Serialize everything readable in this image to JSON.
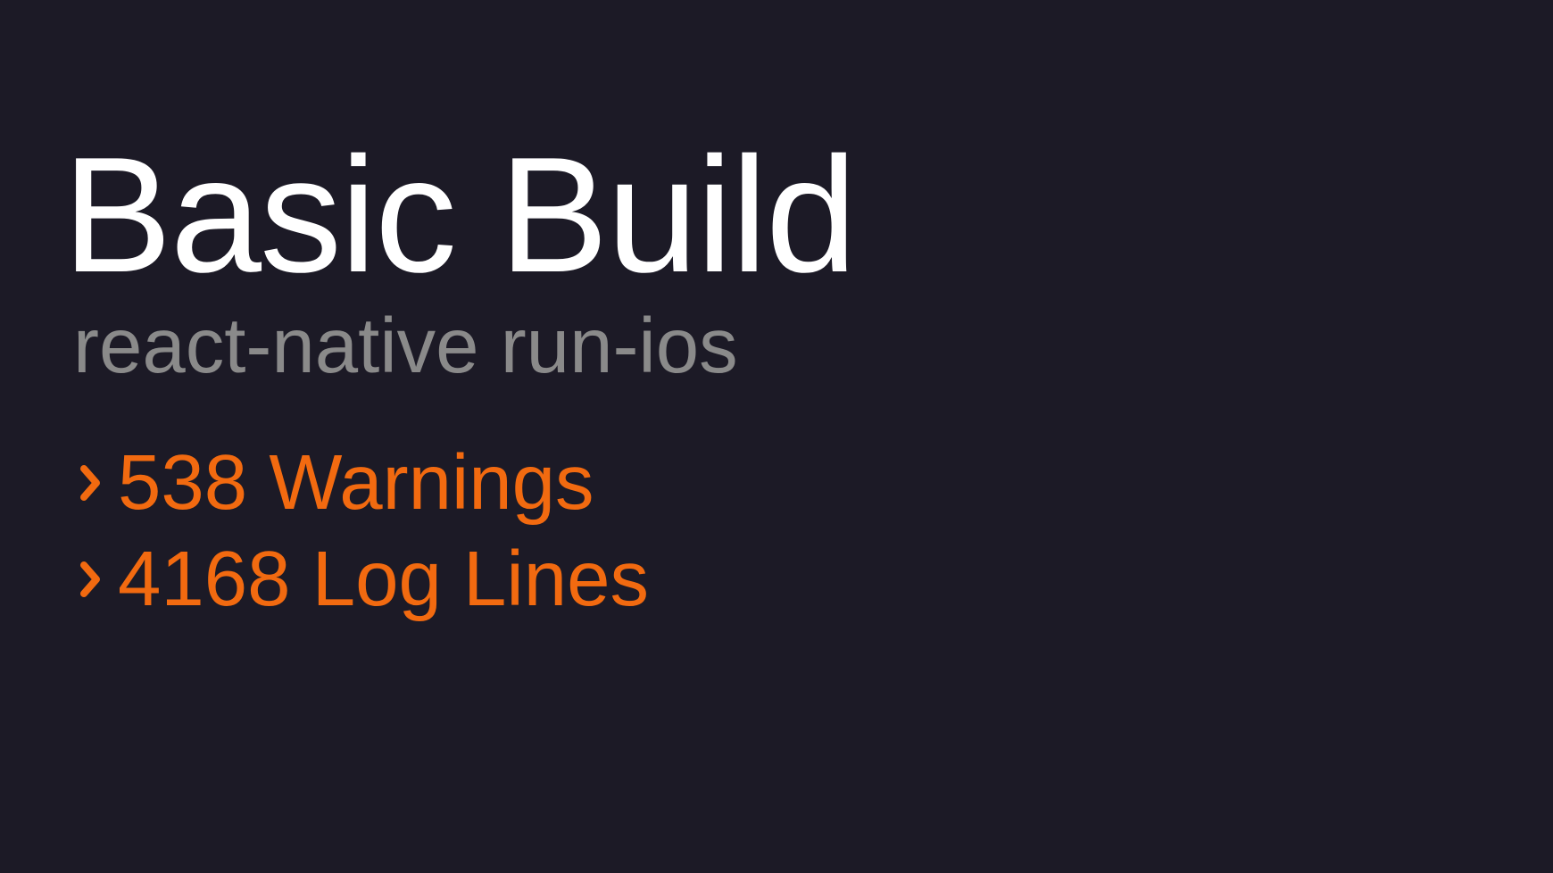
{
  "slide": {
    "title": "Basic Build",
    "subtitle": "react-native run-ios",
    "stats": [
      {
        "icon": "chevron-right-icon",
        "label": "538 Warnings"
      },
      {
        "icon": "chevron-right-icon",
        "label": "4168 Log Lines"
      }
    ]
  },
  "colors": {
    "background": "#1c1a26",
    "title": "#ffffff",
    "subtitle": "#8a8a8a",
    "accent": "#f26a10"
  }
}
